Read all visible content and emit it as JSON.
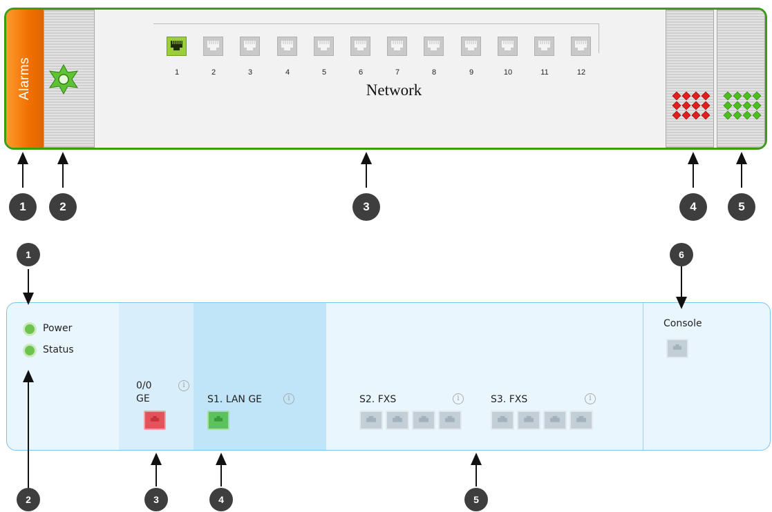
{
  "top_device": {
    "alarms_label": "Alarms",
    "network_label": "Network",
    "ports": [
      {
        "num": "1",
        "active": true
      },
      {
        "num": "2",
        "active": false
      },
      {
        "num": "3",
        "active": false
      },
      {
        "num": "4",
        "active": false
      },
      {
        "num": "5",
        "active": false
      },
      {
        "num": "6",
        "active": false
      },
      {
        "num": "7",
        "active": false
      },
      {
        "num": "8",
        "active": false
      },
      {
        "num": "9",
        "active": false
      },
      {
        "num": "10",
        "active": false
      },
      {
        "num": "11",
        "active": false
      },
      {
        "num": "12",
        "active": false
      }
    ],
    "callouts": [
      "1",
      "2",
      "3",
      "4",
      "5"
    ]
  },
  "bottom_device": {
    "power_label": "Power",
    "status_label": "Status",
    "ge_label_line1": "0/0",
    "ge_label_line2": "GE",
    "lan_label": "S1. LAN GE",
    "fxs2_label": "S2. FXS",
    "fxs3_label": "S3. FXS",
    "console_label": "Console",
    "info_glyph": "i",
    "callouts": [
      "1",
      "6",
      "2",
      "3",
      "4",
      "5"
    ]
  },
  "colors": {
    "frame_green": "#3d9c16",
    "alarms_orange": "#f07000",
    "port_active": "#9ccd3a",
    "led_green": "#6ec34f",
    "ge_port_red": "#e2535b",
    "lan_port_green": "#5cc35c",
    "port_inactive": "#c3cfd6"
  }
}
